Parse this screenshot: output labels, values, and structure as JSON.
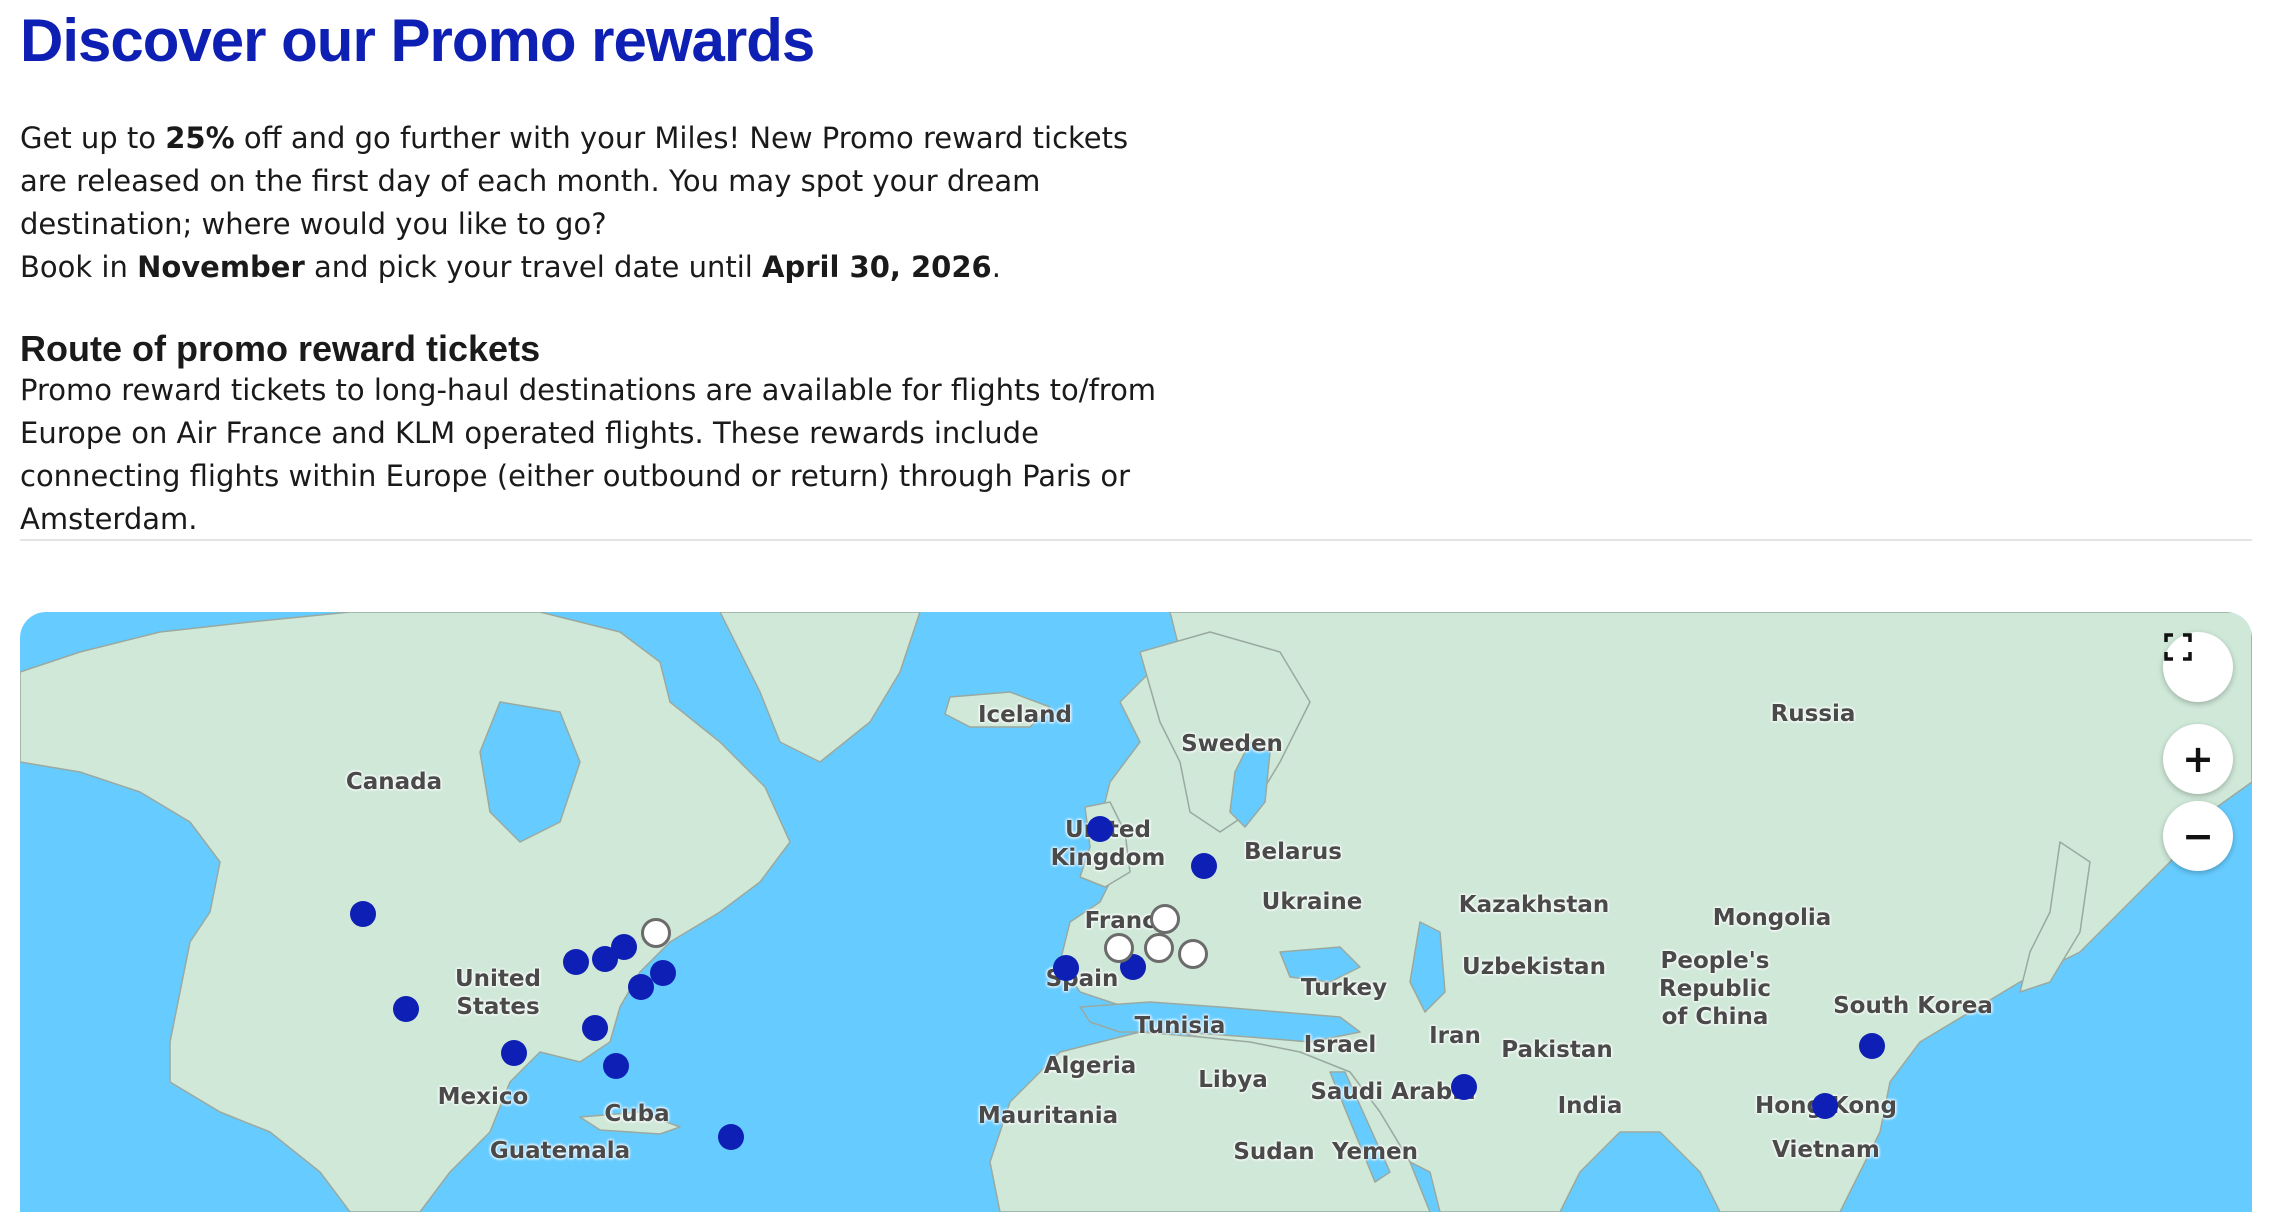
{
  "page": {
    "title": "Discover our Promo rewards",
    "intro": {
      "p1_part1": "Get up to ",
      "p1_bold": "25%",
      "p1_part2": " off and go further with your Miles! New Promo reward tickets are released on the first day of each month. You may spot your dream destination; where would you like to go?",
      "p2_part1": "Book in ",
      "p2_bold1": "November",
      "p2_part2": " and pick your travel date until ",
      "p2_bold2": "April 30, 2026",
      "p2_part3": "."
    },
    "route_heading": "Route of promo reward tickets",
    "route_text": "Promo reward tickets to long-haul destinations are available for flights to/from Europe on Air France and KLM operated flights. These rewards include connecting flights within Europe (either outbound or return) through Paris or Amsterdam."
  },
  "map": {
    "controls": {
      "fullscreen_icon": "fullscreen-icon",
      "zoom_in": "+",
      "zoom_out": "−"
    },
    "colors": {
      "water": "#66ccff",
      "land": "#cfe8d8",
      "destination": "#0d1fb5",
      "hub": "#ffffff"
    },
    "labels": {
      "iceland": "Iceland",
      "russia": "Russia",
      "sweden": "Sweden",
      "canada": "Canada",
      "uk": "United\nKingdom",
      "belarus": "Belarus",
      "ukraine": "Ukraine",
      "kazakhstan": "Kazakhstan",
      "mongolia": "Mongolia",
      "france": "France",
      "uzbekistan": "Uzbekistan",
      "prc": "People's\nRepublic\nof China",
      "us": "United\nStates",
      "spain": "Spain",
      "turkey": "Turkey",
      "south_korea": "South Korea",
      "tunisia": "Tunisia",
      "iran": "Iran",
      "israel": "Israel",
      "pakistan": "Pakistan",
      "algeria": "Algeria",
      "libya": "Libya",
      "mexico": "Mexico",
      "saudi": "Saudi Arabia",
      "india": "India",
      "cuba": "Cuba",
      "hong_kong": "Hong Kong",
      "mauritania": "Mauritania",
      "guatemala": "Guatemala",
      "sudan": "Sudan",
      "yemen": "Yemen",
      "vietnam": "Vietnam"
    }
  }
}
